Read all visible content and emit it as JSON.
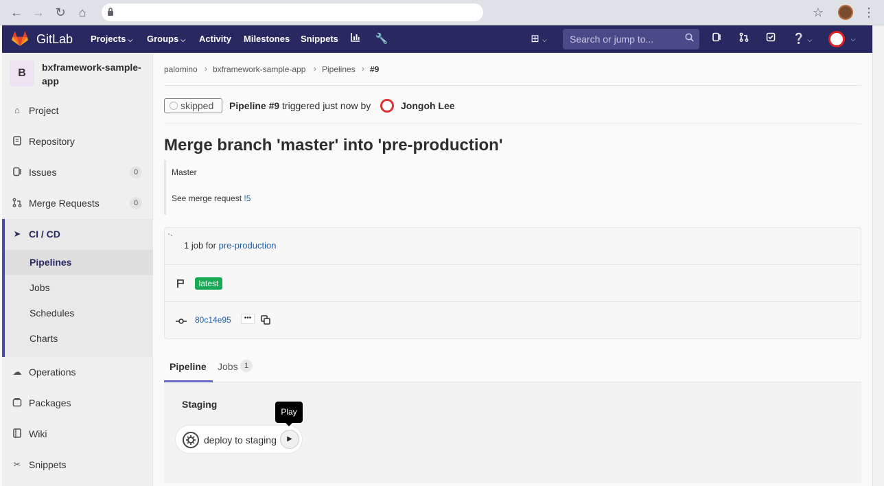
{
  "browser": {
    "back_icon": "arrow-left-icon",
    "forward_icon": "arrow-right-icon",
    "reload_icon": "reload-icon",
    "home_icon": "home-icon",
    "url": "",
    "star_icon": "star-icon",
    "menu_icon": "kebab-menu-icon"
  },
  "navbar": {
    "brand": "GitLab",
    "items": [
      {
        "label": "Projects",
        "dropdown": true
      },
      {
        "label": "Groups",
        "dropdown": true
      },
      {
        "label": "Activity",
        "dropdown": false
      },
      {
        "label": "Milestones",
        "dropdown": false
      },
      {
        "label": "Snippets",
        "dropdown": false
      }
    ],
    "search_placeholder": "Search or jump to..."
  },
  "sidebar": {
    "project_initial": "B",
    "project_name": "bxframework-sample-app",
    "items": [
      {
        "label": "Project",
        "icon": "home-icon"
      },
      {
        "label": "Repository",
        "icon": "doc-icon"
      },
      {
        "label": "Issues",
        "icon": "issues-icon",
        "count": "0"
      },
      {
        "label": "Merge Requests",
        "icon": "merge-request-icon",
        "count": "0"
      },
      {
        "label": "CI / CD",
        "icon": "rocket-icon"
      },
      {
        "label": "Operations",
        "icon": "cloud-gear-icon"
      },
      {
        "label": "Packages",
        "icon": "package-icon"
      },
      {
        "label": "Wiki",
        "icon": "book-icon"
      },
      {
        "label": "Snippets",
        "icon": "scissors-icon"
      }
    ],
    "cicd_sub": [
      "Pipelines",
      "Jobs",
      "Schedules",
      "Charts"
    ]
  },
  "breadcrumb": [
    "palomino",
    "bxframework-sample-app",
    "Pipelines",
    "#9"
  ],
  "pipeline": {
    "status": "skipped",
    "name": "Pipeline #9",
    "triggered_text": "triggered just now by",
    "user": "Jongoh Lee",
    "title": "Merge branch 'master' into 'pre-production'",
    "desc_line1": "Master",
    "desc_line2_prefix": "See merge request",
    "desc_link": "!5",
    "jobs_text": "1 job for",
    "branch": "pre-production",
    "badge_latest": "latest",
    "sha": "80c14e95",
    "ellipsis": "•••"
  },
  "tabs": {
    "pipeline": "Pipeline",
    "jobs": "Jobs",
    "jobs_count": "1"
  },
  "graph": {
    "stage": "Staging",
    "job_name": "deploy to staging",
    "tooltip": "Play"
  },
  "colors": {
    "navbar": "#292961",
    "accent": "#6666c4",
    "success": "#1aaa55",
    "link": "#1f5fa6"
  }
}
